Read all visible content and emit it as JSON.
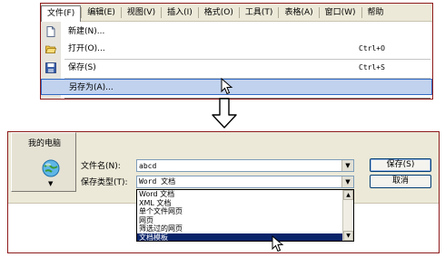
{
  "menubar": {
    "items": [
      {
        "label": "文件(F)"
      },
      {
        "label": "编辑(E)"
      },
      {
        "label": "视图(V)"
      },
      {
        "label": "插入(I)"
      },
      {
        "label": "格式(O)"
      },
      {
        "label": "工具(T)"
      },
      {
        "label": "表格(A)"
      },
      {
        "label": "窗口(W)"
      },
      {
        "label": "帮助"
      }
    ]
  },
  "file_menu": {
    "new": {
      "label": "新建(N)...",
      "icon": "new-document-icon"
    },
    "open": {
      "label": "打开(O)...",
      "shortcut": "Ctrl+O",
      "icon": "open-folder-icon"
    },
    "save": {
      "label": "保存(S)",
      "shortcut": "Ctrl+S",
      "icon": "save-disk-icon"
    },
    "save_as": {
      "label": "另存为(A)...",
      "highlighted": true
    }
  },
  "arrow": {
    "icon": "down-arrow-icon"
  },
  "dialog": {
    "places": {
      "my_computer": "我的电脑",
      "network_icon": "network-globe-icon"
    },
    "filename": {
      "label": "文件名(N):",
      "value": "abcd"
    },
    "filetype": {
      "label": "保存类型(T):",
      "value": "Word 文档",
      "options": [
        "Word 文档",
        "XML 文档",
        "单个文件网页",
        "网页",
        "筛选过的网页",
        "文档模板"
      ],
      "selected_index": 5
    },
    "save_button": "保存(S)",
    "cancel_button": "取消"
  },
  "colors": {
    "menu_bar": "#ece9d8",
    "menu_highlight": "#c1d2ee",
    "menu_highlight_border": "#316ac5",
    "list_selection": "#0a246a",
    "frame_border": "#8e1b1b"
  }
}
